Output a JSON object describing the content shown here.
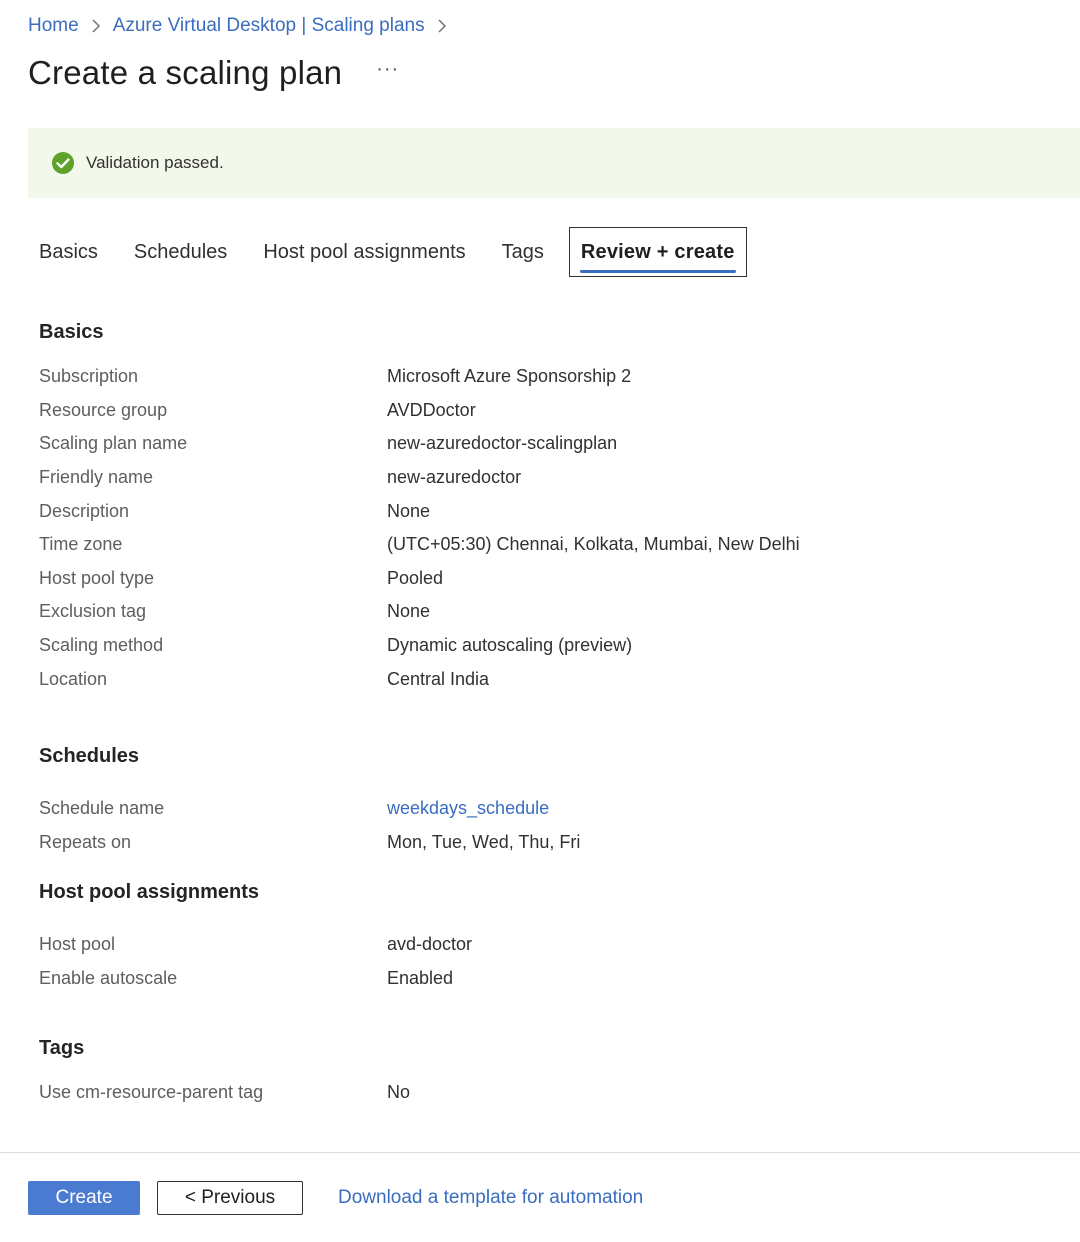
{
  "breadcrumb": {
    "items": [
      "Home",
      "Azure Virtual Desktop | Scaling plans"
    ]
  },
  "page": {
    "title": "Create a scaling plan",
    "more_label": "···"
  },
  "validation": {
    "message": "Validation passed.",
    "color": "#5ea12b"
  },
  "tabs": [
    {
      "label": "Basics"
    },
    {
      "label": "Schedules"
    },
    {
      "label": "Host pool assignments"
    },
    {
      "label": "Tags"
    },
    {
      "label": "Review + create"
    }
  ],
  "active_tab": "Review + create",
  "sections": {
    "basics": {
      "title": "Basics",
      "rows": [
        {
          "label": "Subscription",
          "value": "Microsoft Azure Sponsorship 2"
        },
        {
          "label": "Resource group",
          "value": "AVDDoctor"
        },
        {
          "label": "Scaling plan name",
          "value": "new-azuredoctor-scalingplan"
        },
        {
          "label": "Friendly name",
          "value": "new-azuredoctor"
        },
        {
          "label": "Description",
          "value": "None"
        },
        {
          "label": "Time zone",
          "value": "(UTC+05:30) Chennai, Kolkata, Mumbai, New Delhi"
        },
        {
          "label": "Host pool type",
          "value": "Pooled"
        },
        {
          "label": "Exclusion tag",
          "value": "None"
        },
        {
          "label": "Scaling method",
          "value": "Dynamic autoscaling (preview)"
        },
        {
          "label": "Location",
          "value": "Central India"
        }
      ]
    },
    "schedules": {
      "title": "Schedules",
      "rows": [
        {
          "label": "Schedule name",
          "value": "weekdays_schedule"
        },
        {
          "label": "Repeats on",
          "value": "Mon, Tue, Wed, Thu, Fri"
        }
      ]
    },
    "host_pool_assignments": {
      "title": "Host pool assignments",
      "rows": [
        {
          "label": "Host pool",
          "value": "avd-doctor"
        },
        {
          "label": "Enable autoscale",
          "value": "Enabled"
        }
      ]
    },
    "tags": {
      "title": "Tags",
      "rows": [
        {
          "label": "Use cm-resource-parent tag",
          "value": "No"
        }
      ]
    }
  },
  "footer": {
    "create_label": "Create",
    "previous_label": "< Previous",
    "download_label": "Download a template for automation"
  },
  "colors": {
    "accent": "#4a7bd0",
    "link": "#3a6dbf",
    "success_bg": "#f3f9ea"
  }
}
